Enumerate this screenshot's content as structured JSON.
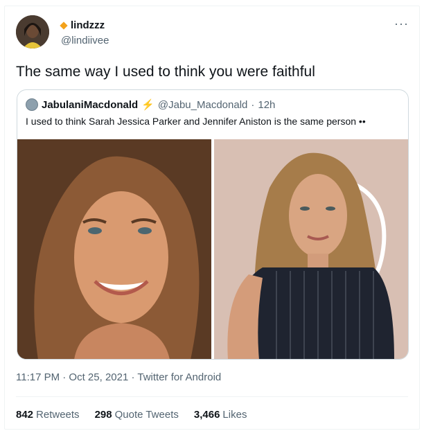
{
  "tweet": {
    "display_name": "lindzzz",
    "handle": "@lindiivee",
    "text": "The same way I used to think you were faithful",
    "more_label": "···"
  },
  "quoted": {
    "display_name": "JabulaniMacdonald",
    "handle": "@Jabu_Macdonald",
    "separator": "·",
    "age": "12h",
    "text": "I used to think Sarah Jessica Parker  and Jennifer Aniston is the same person ••",
    "bolt": "⚡"
  },
  "meta": {
    "time": "11:17 PM · Oct 25, 2021 · Twitter for Android"
  },
  "stats": {
    "retweets_count": "842",
    "retweets_label": "Retweets",
    "quotes_count": "298",
    "quotes_label": "Quote Tweets",
    "likes_count": "3,466",
    "likes_label": "Likes"
  },
  "colors": {
    "verified_diamond": "#f3a21b",
    "secondary_text": "#536471"
  }
}
